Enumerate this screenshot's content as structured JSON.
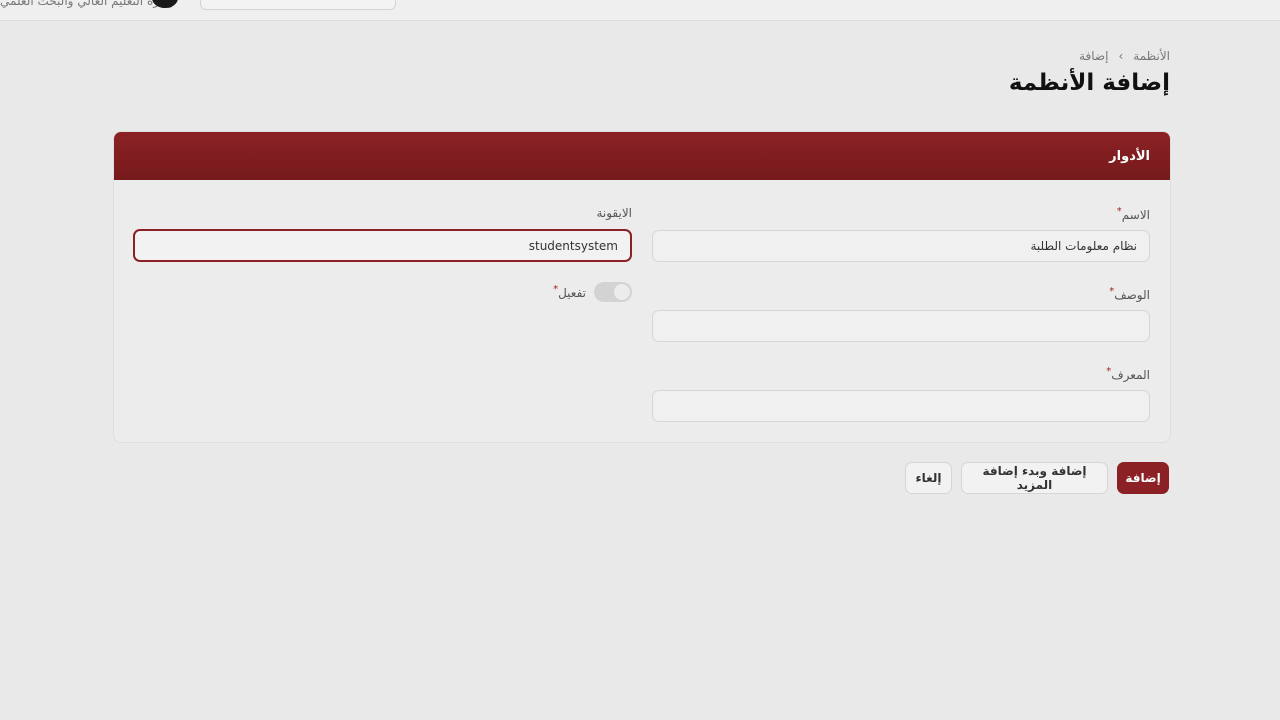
{
  "topbar": {
    "org_name": "وزارة التعليم العالي والبحث العلمي"
  },
  "breadcrumb": {
    "items": [
      "الأنظمة",
      "إضافة"
    ],
    "separator": "›"
  },
  "page": {
    "title": "إضافة الأنظمة"
  },
  "card": {
    "title": "الأدوار"
  },
  "form": {
    "name": {
      "label": "الاسم",
      "value": "نظام معلومات الطلبة",
      "required": "*"
    },
    "icon": {
      "label": "الايقونة",
      "value": "studentsystem"
    },
    "description": {
      "label": "الوصف",
      "value": "",
      "required": "*"
    },
    "identifier": {
      "label": "المعرف",
      "value": "",
      "required": "*"
    },
    "activate": {
      "label": "تفعيل",
      "required": "*"
    }
  },
  "actions": {
    "add": "إضافة",
    "add_more": "إضافة وبدء إضافة المزيد",
    "cancel": "إلغاء"
  },
  "colors": {
    "brand": "#8b2125",
    "background": "#e9e9e9"
  }
}
